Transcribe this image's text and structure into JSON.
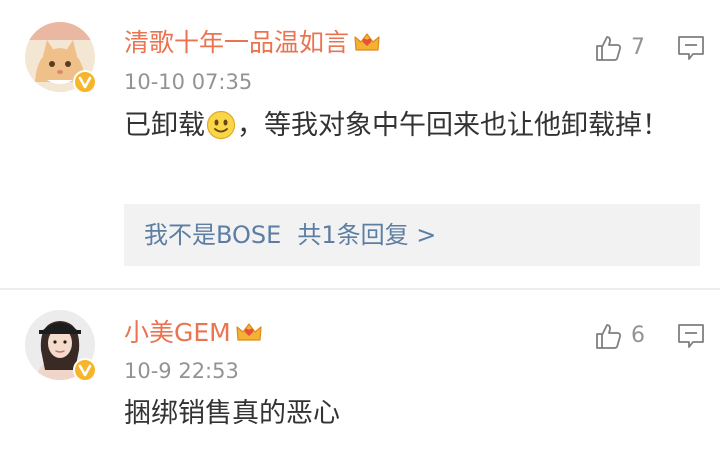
{
  "comments": [
    {
      "username": "清歌十年一品温如言",
      "timestamp": "10-10 07:35",
      "content_before": "已卸载",
      "content_after": "，等我对象中午回来也让他卸载掉！",
      "emoji": "smiley-face-icon",
      "likes": "7",
      "reply_summary": {
        "user": "我不是BOSE",
        "count_text": "共1条回复 >"
      },
      "verified_badge": "verified-v-icon",
      "crown_badge": "crown-icon"
    },
    {
      "username": "小美GEM",
      "timestamp": "10-9 22:53",
      "content": "捆绑销售真的恶心",
      "likes": "6",
      "verified_badge": "verified-v-icon",
      "crown_badge": "crown-icon"
    }
  ],
  "colors": {
    "username": "#eb7350",
    "timestamp": "#939393",
    "content": "#333333",
    "reply_link": "#5d7ea3",
    "reply_background": "#f2f2f2",
    "verified": "#f7b52b",
    "divider": "#ededed"
  }
}
